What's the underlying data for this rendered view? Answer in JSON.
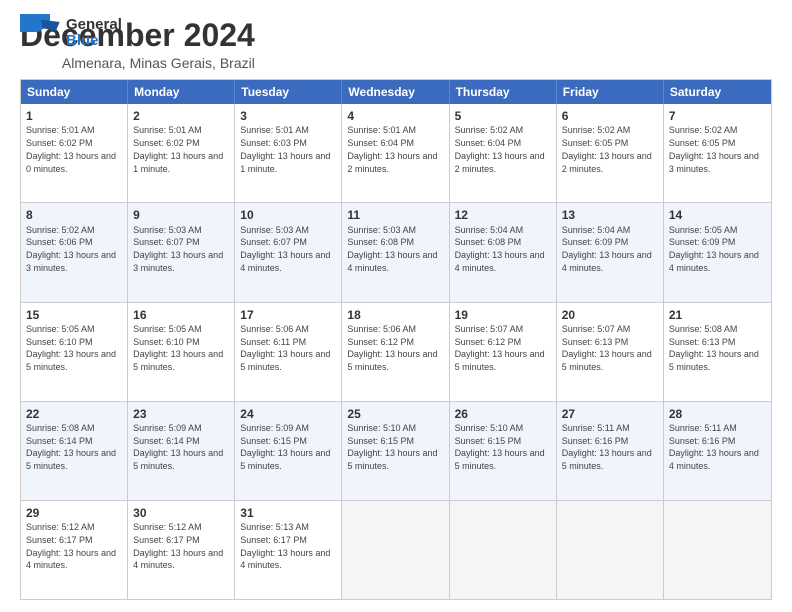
{
  "logo": {
    "general": "General",
    "blue": "Blue"
  },
  "title": "December 2024",
  "location": "Almenara, Minas Gerais, Brazil",
  "header_days": [
    "Sunday",
    "Monday",
    "Tuesday",
    "Wednesday",
    "Thursday",
    "Friday",
    "Saturday"
  ],
  "weeks": [
    [
      {
        "day": "1",
        "sunrise": "Sunrise: 5:01 AM",
        "sunset": "Sunset: 6:02 PM",
        "daylight": "Daylight: 13 hours and 0 minutes."
      },
      {
        "day": "2",
        "sunrise": "Sunrise: 5:01 AM",
        "sunset": "Sunset: 6:02 PM",
        "daylight": "Daylight: 13 hours and 1 minute."
      },
      {
        "day": "3",
        "sunrise": "Sunrise: 5:01 AM",
        "sunset": "Sunset: 6:03 PM",
        "daylight": "Daylight: 13 hours and 1 minute."
      },
      {
        "day": "4",
        "sunrise": "Sunrise: 5:01 AM",
        "sunset": "Sunset: 6:04 PM",
        "daylight": "Daylight: 13 hours and 2 minutes."
      },
      {
        "day": "5",
        "sunrise": "Sunrise: 5:02 AM",
        "sunset": "Sunset: 6:04 PM",
        "daylight": "Daylight: 13 hours and 2 minutes."
      },
      {
        "day": "6",
        "sunrise": "Sunrise: 5:02 AM",
        "sunset": "Sunset: 6:05 PM",
        "daylight": "Daylight: 13 hours and 2 minutes."
      },
      {
        "day": "7",
        "sunrise": "Sunrise: 5:02 AM",
        "sunset": "Sunset: 6:05 PM",
        "daylight": "Daylight: 13 hours and 3 minutes."
      }
    ],
    [
      {
        "day": "8",
        "sunrise": "Sunrise: 5:02 AM",
        "sunset": "Sunset: 6:06 PM",
        "daylight": "Daylight: 13 hours and 3 minutes."
      },
      {
        "day": "9",
        "sunrise": "Sunrise: 5:03 AM",
        "sunset": "Sunset: 6:07 PM",
        "daylight": "Daylight: 13 hours and 3 minutes."
      },
      {
        "day": "10",
        "sunrise": "Sunrise: 5:03 AM",
        "sunset": "Sunset: 6:07 PM",
        "daylight": "Daylight: 13 hours and 4 minutes."
      },
      {
        "day": "11",
        "sunrise": "Sunrise: 5:03 AM",
        "sunset": "Sunset: 6:08 PM",
        "daylight": "Daylight: 13 hours and 4 minutes."
      },
      {
        "day": "12",
        "sunrise": "Sunrise: 5:04 AM",
        "sunset": "Sunset: 6:08 PM",
        "daylight": "Daylight: 13 hours and 4 minutes."
      },
      {
        "day": "13",
        "sunrise": "Sunrise: 5:04 AM",
        "sunset": "Sunset: 6:09 PM",
        "daylight": "Daylight: 13 hours and 4 minutes."
      },
      {
        "day": "14",
        "sunrise": "Sunrise: 5:05 AM",
        "sunset": "Sunset: 6:09 PM",
        "daylight": "Daylight: 13 hours and 4 minutes."
      }
    ],
    [
      {
        "day": "15",
        "sunrise": "Sunrise: 5:05 AM",
        "sunset": "Sunset: 6:10 PM",
        "daylight": "Daylight: 13 hours and 5 minutes."
      },
      {
        "day": "16",
        "sunrise": "Sunrise: 5:05 AM",
        "sunset": "Sunset: 6:10 PM",
        "daylight": "Daylight: 13 hours and 5 minutes."
      },
      {
        "day": "17",
        "sunrise": "Sunrise: 5:06 AM",
        "sunset": "Sunset: 6:11 PM",
        "daylight": "Daylight: 13 hours and 5 minutes."
      },
      {
        "day": "18",
        "sunrise": "Sunrise: 5:06 AM",
        "sunset": "Sunset: 6:12 PM",
        "daylight": "Daylight: 13 hours and 5 minutes."
      },
      {
        "day": "19",
        "sunrise": "Sunrise: 5:07 AM",
        "sunset": "Sunset: 6:12 PM",
        "daylight": "Daylight: 13 hours and 5 minutes."
      },
      {
        "day": "20",
        "sunrise": "Sunrise: 5:07 AM",
        "sunset": "Sunset: 6:13 PM",
        "daylight": "Daylight: 13 hours and 5 minutes."
      },
      {
        "day": "21",
        "sunrise": "Sunrise: 5:08 AM",
        "sunset": "Sunset: 6:13 PM",
        "daylight": "Daylight: 13 hours and 5 minutes."
      }
    ],
    [
      {
        "day": "22",
        "sunrise": "Sunrise: 5:08 AM",
        "sunset": "Sunset: 6:14 PM",
        "daylight": "Daylight: 13 hours and 5 minutes."
      },
      {
        "day": "23",
        "sunrise": "Sunrise: 5:09 AM",
        "sunset": "Sunset: 6:14 PM",
        "daylight": "Daylight: 13 hours and 5 minutes."
      },
      {
        "day": "24",
        "sunrise": "Sunrise: 5:09 AM",
        "sunset": "Sunset: 6:15 PM",
        "daylight": "Daylight: 13 hours and 5 minutes."
      },
      {
        "day": "25",
        "sunrise": "Sunrise: 5:10 AM",
        "sunset": "Sunset: 6:15 PM",
        "daylight": "Daylight: 13 hours and 5 minutes."
      },
      {
        "day": "26",
        "sunrise": "Sunrise: 5:10 AM",
        "sunset": "Sunset: 6:15 PM",
        "daylight": "Daylight: 13 hours and 5 minutes."
      },
      {
        "day": "27",
        "sunrise": "Sunrise: 5:11 AM",
        "sunset": "Sunset: 6:16 PM",
        "daylight": "Daylight: 13 hours and 5 minutes."
      },
      {
        "day": "28",
        "sunrise": "Sunrise: 5:11 AM",
        "sunset": "Sunset: 6:16 PM",
        "daylight": "Daylight: 13 hours and 4 minutes."
      }
    ],
    [
      {
        "day": "29",
        "sunrise": "Sunrise: 5:12 AM",
        "sunset": "Sunset: 6:17 PM",
        "daylight": "Daylight: 13 hours and 4 minutes."
      },
      {
        "day": "30",
        "sunrise": "Sunrise: 5:12 AM",
        "sunset": "Sunset: 6:17 PM",
        "daylight": "Daylight: 13 hours and 4 minutes."
      },
      {
        "day": "31",
        "sunrise": "Sunrise: 5:13 AM",
        "sunset": "Sunset: 6:17 PM",
        "daylight": "Daylight: 13 hours and 4 minutes."
      },
      null,
      null,
      null,
      null
    ]
  ]
}
